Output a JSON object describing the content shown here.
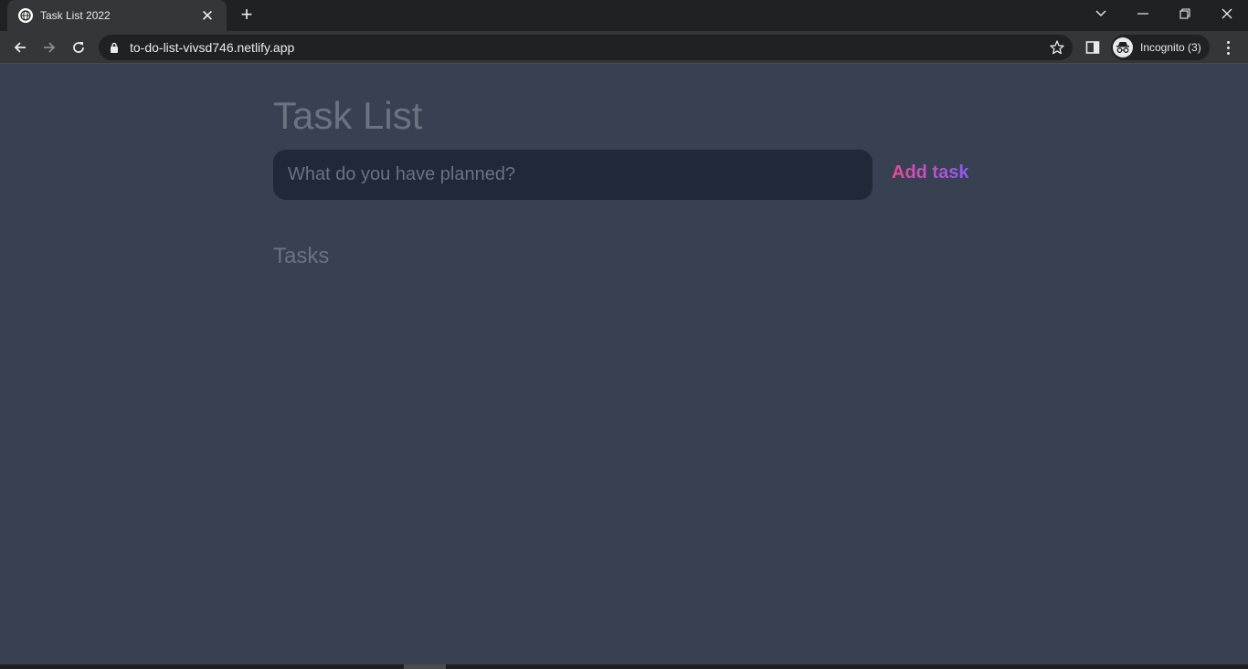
{
  "browser": {
    "tab_title": "Task List 2022",
    "url": "to-do-list-vivsd746.netlify.app",
    "incognito_label": "Incognito (3)",
    "tab_close_glyph": "✕",
    "new_tab_glyph": "+"
  },
  "app": {
    "title": "Task List",
    "input_placeholder": "What do you have planned?",
    "input_value": "",
    "add_button_label": "Add task",
    "tasks_heading": "Tasks",
    "tasks": []
  },
  "colors": {
    "page_bg": "#374151",
    "input_bg": "#1f2937",
    "muted_text": "#6b7280",
    "accent_gradient_start": "#ec4899",
    "accent_gradient_end": "#8b5cf6"
  },
  "icons": {
    "favicon": "globe-icon",
    "back": "arrow-left-icon",
    "forward": "arrow-right-icon",
    "reload": "reload-icon",
    "lock": "lock-icon",
    "bookmark": "star-icon",
    "side_panel": "side-panel-icon",
    "incognito": "incognito-icon",
    "menu": "more-vert-icon",
    "tab_search": "chevron-down-icon",
    "minimize": "minimize-icon",
    "restore": "restore-icon",
    "close": "close-icon"
  }
}
